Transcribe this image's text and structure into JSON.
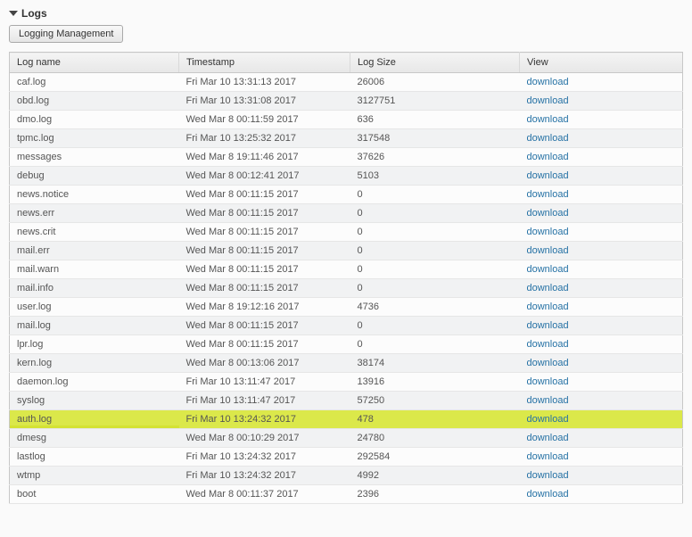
{
  "section": {
    "title": "Logs"
  },
  "buttons": {
    "logging_management": "Logging Management"
  },
  "table": {
    "columns": {
      "name": "Log name",
      "timestamp": "Timestamp",
      "size": "Log Size",
      "view": "View"
    },
    "download_label": "download",
    "rows": [
      {
        "name": "caf.log",
        "timestamp": "Fri Mar 10 13:31:13 2017",
        "size": "26006",
        "highlight": false
      },
      {
        "name": "obd.log",
        "timestamp": "Fri Mar 10 13:31:08 2017",
        "size": "3127751",
        "highlight": false
      },
      {
        "name": "dmo.log",
        "timestamp": "Wed Mar 8 00:11:59 2017",
        "size": "636",
        "highlight": false
      },
      {
        "name": "tpmc.log",
        "timestamp": "Fri Mar 10 13:25:32 2017",
        "size": "317548",
        "highlight": false
      },
      {
        "name": "messages",
        "timestamp": "Wed Mar 8 19:11:46 2017",
        "size": "37626",
        "highlight": false
      },
      {
        "name": "debug",
        "timestamp": "Wed Mar 8 00:12:41 2017",
        "size": "5103",
        "highlight": false
      },
      {
        "name": "news.notice",
        "timestamp": "Wed Mar 8 00:11:15 2017",
        "size": "0",
        "highlight": false
      },
      {
        "name": "news.err",
        "timestamp": "Wed Mar 8 00:11:15 2017",
        "size": "0",
        "highlight": false
      },
      {
        "name": "news.crit",
        "timestamp": "Wed Mar 8 00:11:15 2017",
        "size": "0",
        "highlight": false
      },
      {
        "name": "mail.err",
        "timestamp": "Wed Mar 8 00:11:15 2017",
        "size": "0",
        "highlight": false
      },
      {
        "name": "mail.warn",
        "timestamp": "Wed Mar 8 00:11:15 2017",
        "size": "0",
        "highlight": false
      },
      {
        "name": "mail.info",
        "timestamp": "Wed Mar 8 00:11:15 2017",
        "size": "0",
        "highlight": false
      },
      {
        "name": "user.log",
        "timestamp": "Wed Mar 8 19:12:16 2017",
        "size": "4736",
        "highlight": false
      },
      {
        "name": "mail.log",
        "timestamp": "Wed Mar 8 00:11:15 2017",
        "size": "0",
        "highlight": false
      },
      {
        "name": "lpr.log",
        "timestamp": "Wed Mar 8 00:11:15 2017",
        "size": "0",
        "highlight": false
      },
      {
        "name": "kern.log",
        "timestamp": "Wed Mar 8 00:13:06 2017",
        "size": "38174",
        "highlight": false
      },
      {
        "name": "daemon.log",
        "timestamp": "Fri Mar 10 13:11:47 2017",
        "size": "13916",
        "highlight": false
      },
      {
        "name": "syslog",
        "timestamp": "Fri Mar 10 13:11:47 2017",
        "size": "57250",
        "highlight": false
      },
      {
        "name": "auth.log",
        "timestamp": "Fri Mar 10 13:24:32 2017",
        "size": "478",
        "highlight": true
      },
      {
        "name": "dmesg",
        "timestamp": "Wed Mar 8 00:10:29 2017",
        "size": "24780",
        "highlight": false
      },
      {
        "name": "lastlog",
        "timestamp": "Fri Mar 10 13:24:32 2017",
        "size": "292584",
        "highlight": false
      },
      {
        "name": "wtmp",
        "timestamp": "Fri Mar 10 13:24:32 2017",
        "size": "4992",
        "highlight": false
      },
      {
        "name": "boot",
        "timestamp": "Wed Mar 8 00:11:37 2017",
        "size": "2396",
        "highlight": false
      }
    ]
  }
}
